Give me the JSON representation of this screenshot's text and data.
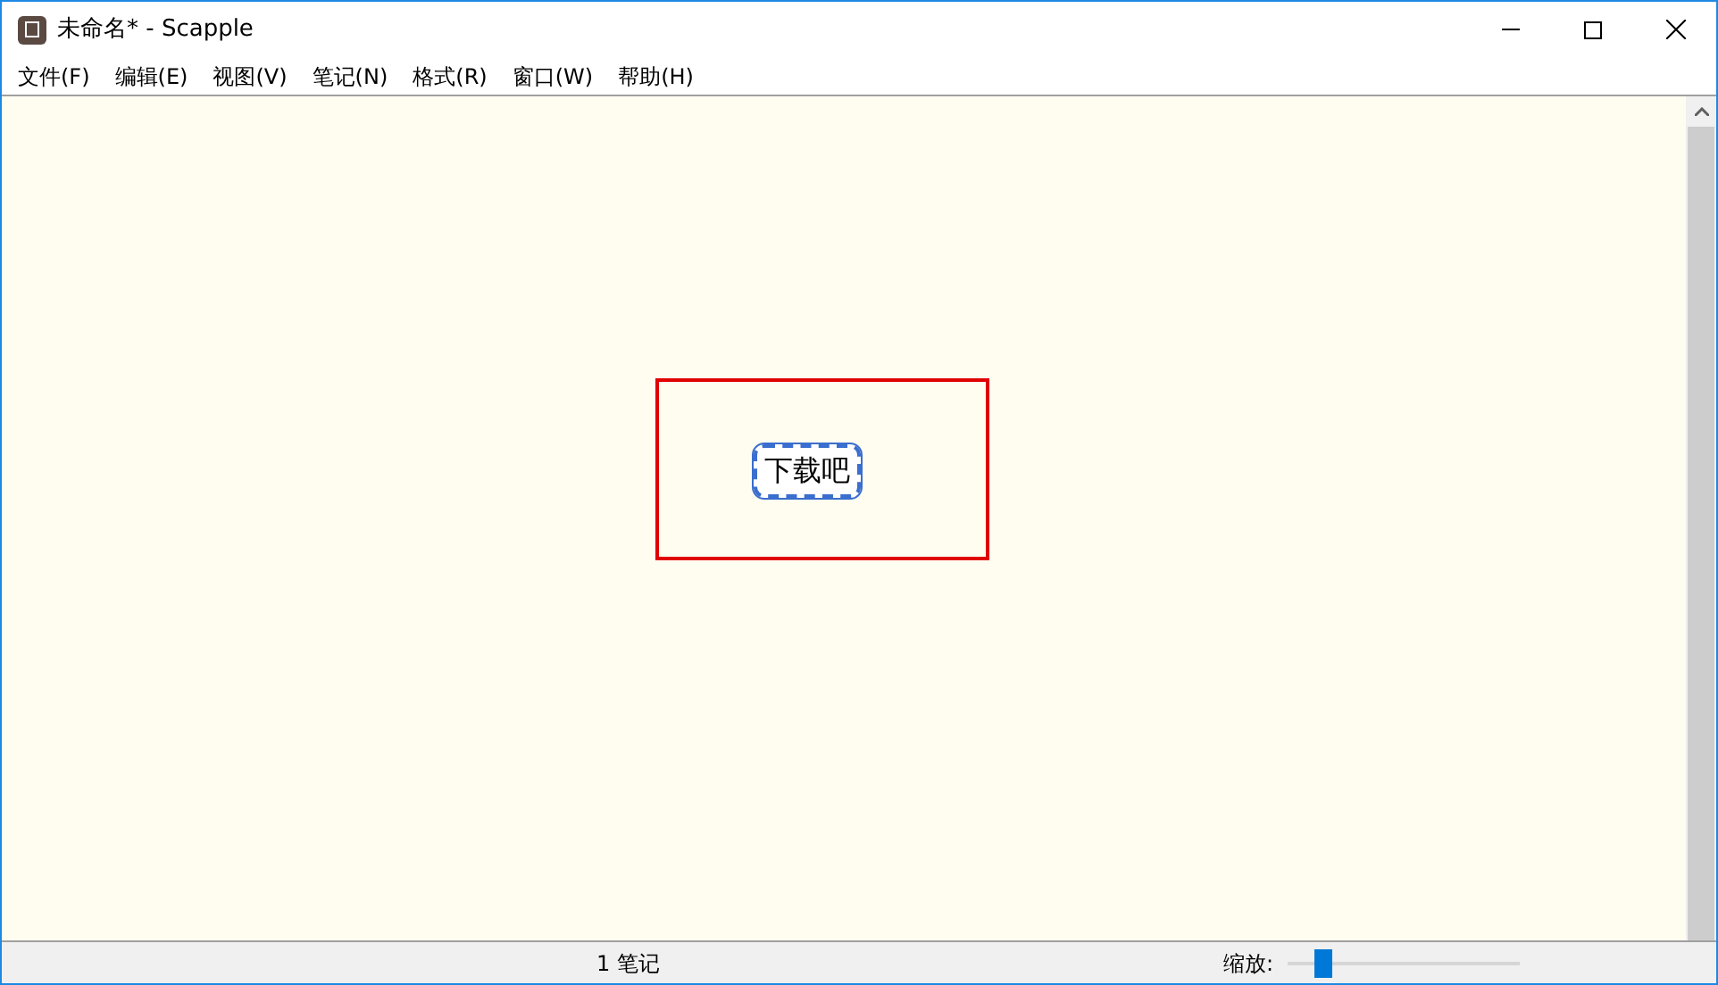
{
  "window": {
    "title": "未命名* - Scapple"
  },
  "menu": [
    "文件(F)",
    "编辑(E)",
    "视图(V)",
    "笔记(N)",
    "格式(R)",
    "窗口(W)",
    "帮助(H)"
  ],
  "canvas": {
    "notes": [
      {
        "text": "下载吧",
        "selected": true
      }
    ]
  },
  "status_bar": {
    "note_count": "1 笔记",
    "zoom_label": "缩放:",
    "zoom": {
      "level": 0.15
    }
  }
}
